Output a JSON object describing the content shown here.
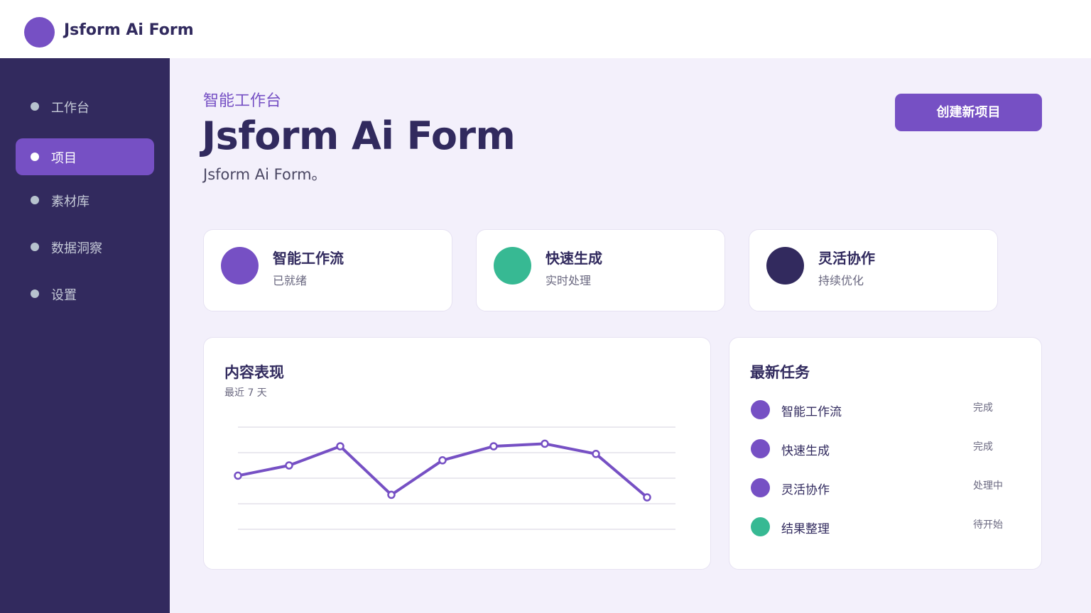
{
  "app": {
    "brand": "Jsform Ai Form"
  },
  "colors": {
    "accent": "#7650c4",
    "green": "#37b993",
    "dark": "#322a5e"
  },
  "sidebar": {
    "items": [
      {
        "label": "工作台",
        "icon": "dot-icon",
        "active": false
      },
      {
        "label": "项目",
        "icon": "dot-icon",
        "active": true
      },
      {
        "label": "素材库",
        "icon": "dot-icon",
        "active": false
      },
      {
        "label": "数据洞察",
        "icon": "dot-icon",
        "active": false
      },
      {
        "label": "设置",
        "icon": "dot-icon",
        "active": false
      }
    ]
  },
  "header": {
    "eyebrow": "智能工作台",
    "title": "Jsform Ai Form",
    "subtitle": "Jsform Ai Form。",
    "create_button": "创建新项目"
  },
  "features": [
    {
      "title": "智能工作流",
      "subtitle": "已就绪",
      "color": "#7650c4"
    },
    {
      "title": "快速生成",
      "subtitle": "实时处理",
      "color": "#37b993"
    },
    {
      "title": "灵活协作",
      "subtitle": "持续优化",
      "color": "#322a5e"
    }
  ],
  "performance": {
    "title": "内容表现",
    "subtitle": "最近 7 天"
  },
  "chart_data": {
    "type": "line",
    "title": "内容表现",
    "subtitle": "最近 7 天",
    "xlabel": "",
    "ylabel": "",
    "series": [
      {
        "values": [
          42,
          50,
          65,
          27,
          54,
          65,
          67,
          59,
          25
        ]
      }
    ],
    "ylim": [
      0,
      80
    ],
    "grid": true,
    "color": "#7650c4"
  },
  "tasks": {
    "title": "最新任务",
    "items": [
      {
        "name": "智能工作流",
        "status": "完成",
        "color": "#7650c4"
      },
      {
        "name": "快速生成",
        "status": "完成",
        "color": "#7650c4"
      },
      {
        "name": "灵活协作",
        "status": "处理中",
        "color": "#7650c4"
      },
      {
        "name": "结果整理",
        "status": "待开始",
        "color": "#37b993"
      }
    ]
  }
}
